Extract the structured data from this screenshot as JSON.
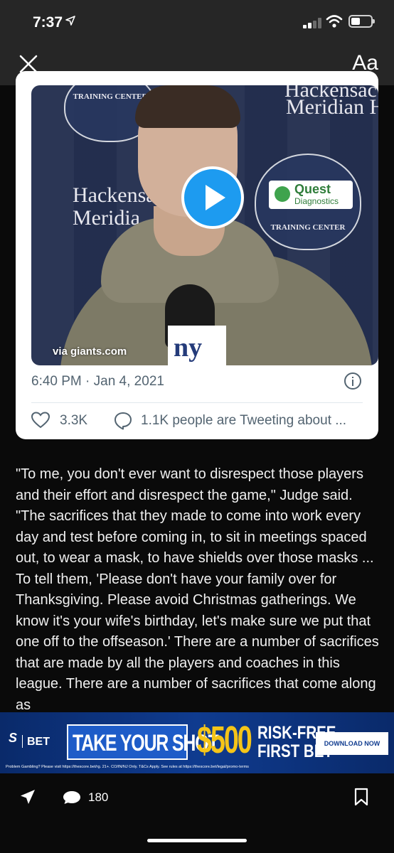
{
  "status_bar": {
    "time": "7:37"
  },
  "reader_bar": {
    "font_label": "Aa"
  },
  "tweet": {
    "video_credit": "via giants.com",
    "backdrop_text": {
      "top_right": "Hackensac",
      "top_right_2": "Meridian H",
      "left": "Hackensa",
      "left_2": "Meridia",
      "badge_text": "TRAINING CENTER",
      "quest_1": "Quest",
      "quest_2": "Diagnostics",
      "mic_flag": "ny"
    },
    "timestamp": "6:40 PM · Jan 4, 2021",
    "like_count": "3.3K",
    "tweeting_text": "1.1K people are Tweeting about ..."
  },
  "article": {
    "paragraph": "\"To me, you don't ever want to disrespect those players and their effort and disrespect the game,\" Judge said. \"The sacrifices that they made to come into work every day and test before coming in, to sit in meetings spaced out, to wear a mask, to have shields over those masks ... To tell them, 'Please don't have your family over for Thanksgiving. Please avoid Christmas gatherings. We know it's your wife's birthday, let's make sure we put that one off to the offseason.' There are a number of sacrifices that are made by all the players and coaches in this league. There are a number of sacrifices that come along as"
  },
  "ad": {
    "brand_s": "S",
    "brand_bet": "BET",
    "take_shot": "TAKE YOUR SHOT",
    "amount": "$500",
    "risk_free": "RISK-FREE",
    "first_bet": "FIRST BET",
    "download": "DOWNLOAD NOW",
    "disclaimer": "Problem Gambling? Please visit https://thescore.bet/rg. 21+. CO/IN/NJ Only. T&Cs Apply. See rules at https://thescore.bet/legal/promo-terms"
  },
  "bottom_bar": {
    "comment_count": "180"
  },
  "colors": {
    "accent": "#1d9bf0",
    "ad_blue": "#0f3b8f",
    "ad_gold": "#f5c518"
  }
}
